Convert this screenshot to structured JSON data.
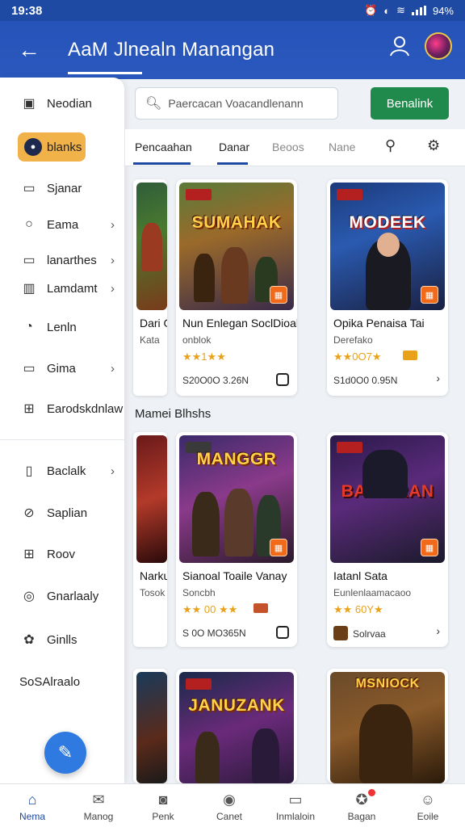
{
  "status": {
    "time": "19:38",
    "battery": "94%"
  },
  "appbar": {
    "title": "AaM Jlnealn Manangan"
  },
  "sidebar": {
    "items": [
      {
        "label": "Neodian",
        "icon": "grid-icon"
      },
      {
        "label": "blanks",
        "icon": "game-icon",
        "active": true
      },
      {
        "label": "Sjanar",
        "icon": "store-icon"
      },
      {
        "label": "Eama",
        "icon": "search-icon",
        "chevron": true
      },
      {
        "label": "lanarthes",
        "icon": "rect-icon",
        "chevron": true
      },
      {
        "label": "Lamdamt",
        "icon": "book-icon",
        "chevron": true
      },
      {
        "label": "Lenln",
        "icon": "clock-icon"
      },
      {
        "label": "Gima",
        "icon": "window-icon",
        "chevron": true
      },
      {
        "label": "Earodskdnlaw",
        "icon": "apps-icon"
      },
      {
        "label": "Baclalk",
        "icon": "folder-icon",
        "chevron": true
      },
      {
        "label": "Saplian",
        "icon": "link-icon"
      },
      {
        "label": "Roov",
        "icon": "grid-icon"
      },
      {
        "label": "Gnarlaaly",
        "icon": "coin-icon"
      },
      {
        "label": "Ginlls",
        "icon": "puzzle-icon"
      },
      {
        "label": "SoSAlraalo"
      }
    ]
  },
  "search": {
    "placeholder": "Paercacan Voacandlenann"
  },
  "action_button": "Benalink",
  "tabs": [
    "Pencaahan",
    "Danar",
    "Beoos",
    "Nane"
  ],
  "section": "Mamei Blhshs",
  "cards": [
    {
      "title": "Dari G",
      "sub": "Kata"
    },
    {
      "logo": "SUMAHAK",
      "title": "Nun Enlegan SoclDioal",
      "sub": "onblok",
      "stars": "★★1★★",
      "price": "S20O0O 3.26N"
    },
    {
      "logo": "MODEEK",
      "title": "Opika Penaisa Tai",
      "sub": "Derefako",
      "stars": "★★0O7★",
      "price": "S1d0O0 0.95N"
    },
    {
      "title": "Narku",
      "sub": "Tosok"
    },
    {
      "logo": "MANGGR",
      "title": "Sianoal Toaile Vanay",
      "sub": "Soncbh",
      "stars": "★★ 00 ★★",
      "price": "S 0O MO365N"
    },
    {
      "logo": "BASUIRAN",
      "title": "Iatanl Sata",
      "sub": "Eunlenlaamacaoo",
      "stars": "★★ 60Y★",
      "sub2": "Solrvaa"
    },
    {
      "logo": "JANUZANK"
    },
    {
      "logo": "MSNIOCK"
    }
  ],
  "bottomnav": [
    {
      "label": "Nema",
      "icon": "home-icon",
      "active": true
    },
    {
      "label": "Manog",
      "icon": "mail-icon"
    },
    {
      "label": "Penk",
      "icon": "bag-icon"
    },
    {
      "label": "Canet",
      "icon": "compass-icon"
    },
    {
      "label": "Inmlaloin",
      "icon": "inbox-icon"
    },
    {
      "label": "Bagan",
      "icon": "gift-icon",
      "badge": true
    },
    {
      "label": "Eoile",
      "icon": "profile-icon"
    }
  ],
  "colors": {
    "primary": "#1f4aa3",
    "accent_green": "#1f8a4c",
    "active_sidebar": "#f2b24a"
  }
}
